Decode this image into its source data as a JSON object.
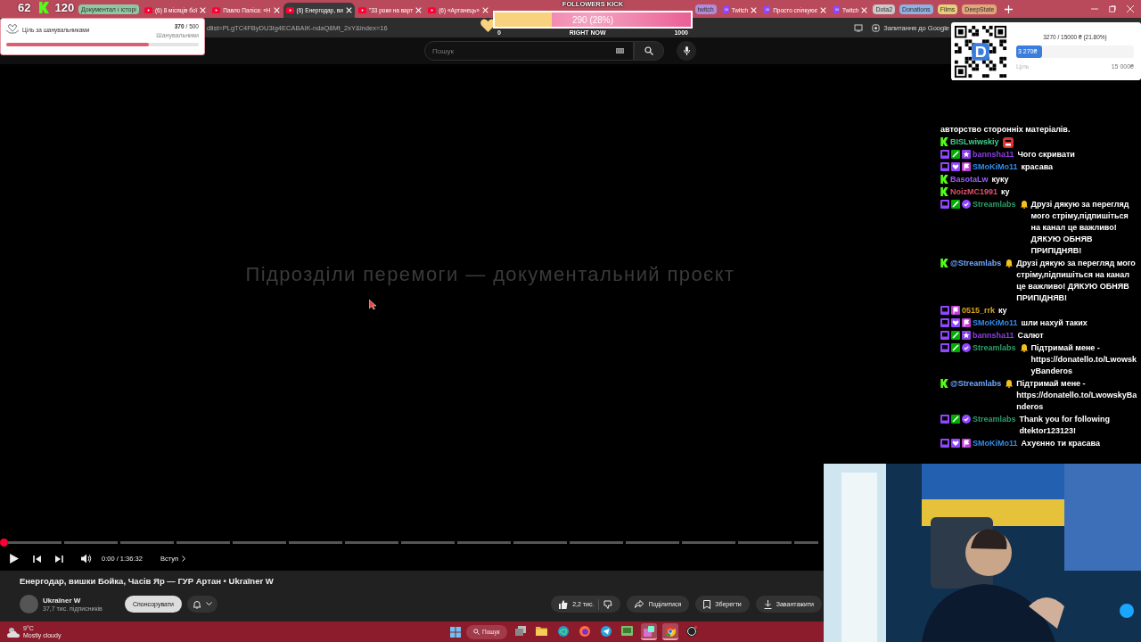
{
  "browser": {
    "tab_sections": [
      {
        "items": [
          {
            "kind": "group",
            "label": "Документал і історі",
            "color": "#8fc9a3"
          },
          {
            "kind": "youtube_tab",
            "label": "(6) 8 місяців бої",
            "selected": false
          },
          {
            "kind": "youtube_tab",
            "label": "Павло Паліса: «Н",
            "selected": false
          },
          {
            "kind": "youtube_tab",
            "label": "(6) Енергодар, ви",
            "selected": true
          },
          {
            "kind": "youtube_tab",
            "label": "\"33 роки на варт",
            "selected": false
          },
          {
            "kind": "youtube_tab",
            "label": "(6) «Артанець»",
            "selected": false
          }
        ]
      },
      {
        "items": [
          {
            "kind": "group",
            "label": "twitch",
            "color": "#b18ad9"
          },
          {
            "kind": "twitch_tab",
            "label": "Twitch",
            "selected": false
          },
          {
            "kind": "twitch_tab",
            "label": "Просто спілкуює",
            "selected": false
          },
          {
            "kind": "twitch_tab",
            "label": "Twitch",
            "selected": false
          },
          {
            "kind": "group",
            "label": "Dota2",
            "color": "#c9c9c9"
          },
          {
            "kind": "group",
            "label": "Donations",
            "color": "#8fb0e0"
          },
          {
            "kind": "group",
            "label": "Films",
            "color": "#e6cf7a"
          },
          {
            "kind": "group",
            "label": "DeepState",
            "color": "#e0a57a"
          },
          {
            "kind": "new"
          }
        ]
      }
    ],
    "url": "dlist=PLgTC4FByDU3Ig4ECABAIK-ndaQ8Mt_2xY&index=16",
    "lens_label": "Запитання до Google"
  },
  "youtube": {
    "search": {
      "placeholder": "Пошук"
    },
    "video": {
      "overlay_title": "Підрозділи перемоги — документальний проєкт",
      "progress": {
        "level": 0.0
      },
      "playing": false,
      "time": "0:00 / 1:36:32",
      "chapter": "Вступ"
    },
    "title": "Енергодар, вишки Бойка, Часів Яр — ГУР Артан • Ukraїner W",
    "channel": {
      "name": "Ukraїner W",
      "subscribers": "37,7 тис. підписників",
      "sponsor_button": "Спонсорувати"
    },
    "actions": {
      "likes": "2,2 тис.",
      "share": "Поділитися",
      "save": "Зберегти",
      "download": "Завантажити"
    }
  },
  "taskbar": {
    "weather": {
      "temperature": "9°C",
      "condition": "Mostly cloudy"
    },
    "search": "Пошук",
    "apps": [
      {
        "kind": "taskview",
        "active": false
      },
      {
        "kind": "folder",
        "active": false
      },
      {
        "kind": "edge",
        "active": false
      },
      {
        "kind": "firefox",
        "active": false
      },
      {
        "kind": "telegram",
        "active": false
      },
      {
        "kind": "chatapp",
        "active": false
      },
      {
        "kind": "streamlabs",
        "active": true
      },
      {
        "kind": "chrome",
        "active": true
      },
      {
        "kind": "obs",
        "active": false
      }
    ]
  },
  "overlays": {
    "counters": [
      {
        "kind": "viewers",
        "value": "62"
      },
      {
        "kind": "kick",
        "value": "120"
      }
    ],
    "fan_goal": {
      "title": "Ціль за шанувальниками",
      "current": "370",
      "total": "/ 500",
      "unit": "Шанувальники",
      "level": 0.74
    },
    "followers_kick": {
      "title": "FOLLOWERS KICK",
      "reading": "290 (28%)",
      "min": "0",
      "label": "RIGHT NOW",
      "max": "1000",
      "level": 0.29
    },
    "donation_goal": {
      "summary": "3270 / 15000 ₴ (21.80%)",
      "amount": "3 270₴",
      "goal_label": "Ціль",
      "goal": "15 000₴",
      "level": 0.218
    },
    "chat": {
      "messages": [
        {
          "text": "авторство сторонніх матеріалів.",
          "emote": false,
          "alert": false
        },
        {
          "badges": [
            {
              "kind": "kick"
            }
          ],
          "user": "BISLwiwskiy",
          "color": "#3fd08a",
          "emote": true,
          "alert": false
        },
        {
          "badges": [
            {
              "kind": "twitch"
            },
            {
              "kind": "mod"
            },
            {
              "kind": "star"
            }
          ],
          "user": "bannsha11",
          "color": "#8a3fe0",
          "text": "Чого скривати",
          "emote": false,
          "alert": false
        },
        {
          "badges": [
            {
              "kind": "twitch"
            },
            {
              "kind": "heart"
            },
            {
              "kind": "sub"
            }
          ],
          "user": "SMoKiMo11",
          "color": "#2f8cf0",
          "text": "красава",
          "emote": false,
          "alert": false
        },
        {
          "badges": [
            {
              "kind": "kick"
            }
          ],
          "user": "BasotaLw",
          "color": "#9b5cff",
          "text": "куку",
          "emote": false,
          "alert": false
        },
        {
          "badges": [
            {
              "kind": "kick"
            }
          ],
          "user": "NoizMC1991",
          "color": "#e0506a",
          "text": "ку",
          "emote": false,
          "alert": false
        },
        {
          "badges": [
            {
              "kind": "twitch"
            },
            {
              "kind": "mod"
            },
            {
              "kind": "verified"
            }
          ],
          "user": "Streamlabs",
          "color": "#2e9e6a",
          "text": "Друзі дякую за перегляд мого стріму,підпишіться на канал це важливо! ДЯКУЮ ОБНЯВ ПРИПІДНЯВ!",
          "emote": false,
          "alert": true
        },
        {
          "badges": [
            {
              "kind": "kick"
            }
          ],
          "user": "@Streamlabs",
          "color": "#6fa8ff",
          "text": "Друзі дякую за перегляд мого стріму,підпишіться на канал це важливо! ДЯКУЮ ОБНЯВ ПРИПІДНЯВ!",
          "emote": false,
          "alert": true
        },
        {
          "badges": [
            {
              "kind": "twitch"
            },
            {
              "kind": "sub"
            }
          ],
          "user": "0515_rrk",
          "color": "#daa520",
          "text": "ку",
          "emote": false,
          "alert": false
        },
        {
          "badges": [
            {
              "kind": "twitch"
            },
            {
              "kind": "heart"
            },
            {
              "kind": "sub"
            }
          ],
          "user": "SMoKiMo11",
          "color": "#2f8cf0",
          "text": "шли нахуй таких",
          "emote": false,
          "alert": false
        },
        {
          "badges": [
            {
              "kind": "twitch"
            },
            {
              "kind": "mod"
            },
            {
              "kind": "star"
            }
          ],
          "user": "bannsha11",
          "color": "#8a3fe0",
          "text": "Салют",
          "emote": false,
          "alert": false
        },
        {
          "badges": [
            {
              "kind": "twitch"
            },
            {
              "kind": "mod"
            },
            {
              "kind": "verified"
            }
          ],
          "user": "Streamlabs",
          "color": "#2e9e6a",
          "text": "Підтримай мене - https://donatello.to/LwowskyBanderos",
          "emote": false,
          "alert": true
        },
        {
          "badges": [
            {
              "kind": "kick"
            }
          ],
          "user": "@Streamlabs",
          "color": "#6fa8ff",
          "text": "Підтримай мене - https://donatello.to/LwowskyBanderos",
          "emote": false,
          "alert": true
        },
        {
          "badges": [
            {
              "kind": "twitch"
            },
            {
              "kind": "mod"
            },
            {
              "kind": "verified"
            }
          ],
          "user": "Streamlabs",
          "color": "#2e9e6a",
          "text": "Thank you for following dtektor123123!",
          "emote": false,
          "alert": false
        },
        {
          "badges": [
            {
              "kind": "twitch"
            },
            {
              "kind": "heart"
            },
            {
              "kind": "sub"
            }
          ],
          "user": "SMoKiMo11",
          "color": "#2f8cf0",
          "text": "Ахуєнно ти красава",
          "emote": false,
          "alert": false
        }
      ]
    }
  }
}
